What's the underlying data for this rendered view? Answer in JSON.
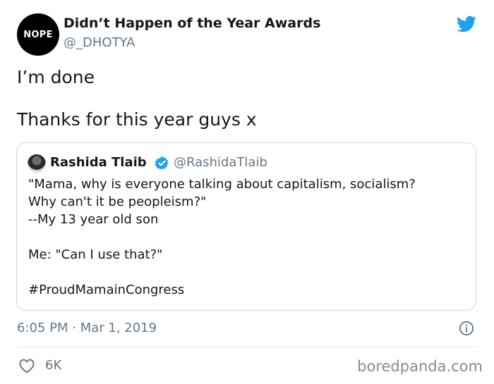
{
  "tweet": {
    "avatar_text": "NOPE",
    "display_name": "Didn’t Happen of the Year Awards",
    "handle": "@_DHOTYA",
    "text_line1": "I’m done",
    "text_line2": "Thanks for this year guys x",
    "timestamp": "6:05 PM · Mar 1, 2019",
    "likes": "6K"
  },
  "quoted_tweet": {
    "display_name": "Rashida Tlaib",
    "handle": "@RashidaTlaib",
    "lines": [
      "\"Mama, why is everyone talking about capitalism, socialism?",
      "Why can't it be peopleism?\"",
      "--My 13 year old son",
      "Me: \"Can I use that?\"",
      "#ProudMamainCongress"
    ]
  },
  "icons": {
    "brand": "twitter-bird-icon",
    "verified": "verified-badge-icon",
    "info": "info-icon",
    "like": "heart-icon"
  },
  "colors": {
    "twitter_blue": "#1da1f2",
    "secondary_text": "#657786",
    "border": "#ccd6dd"
  },
  "watermark": "boredpanda.com"
}
